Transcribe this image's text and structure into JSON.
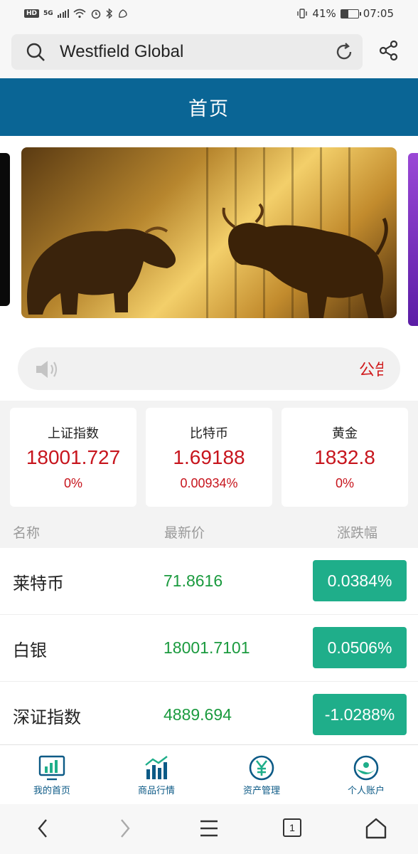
{
  "status_bar": {
    "network_badge": "HD",
    "network_type": "5G",
    "battery_level": "41%",
    "time": "07:05"
  },
  "search": {
    "value": "Westfield Global"
  },
  "header": {
    "title": "首页"
  },
  "notice": {
    "text": "公告"
  },
  "index_cards": [
    {
      "name": "上证指数",
      "price": "18001.727",
      "change": "0%"
    },
    {
      "name": "比特币",
      "price": "1.69188",
      "change": "0.00934%"
    },
    {
      "name": "黄金",
      "price": "1832.8",
      "change": "0%"
    }
  ],
  "table": {
    "headers": {
      "name": "名称",
      "price": "最新价",
      "change": "涨跌幅"
    },
    "rows": [
      {
        "name": "莱特币",
        "price": "71.8616",
        "change": "0.0384%"
      },
      {
        "name": "白银",
        "price": "18001.7101",
        "change": "0.0506%"
      },
      {
        "name": "深证指数",
        "price": "4889.694",
        "change": "-1.0288%"
      }
    ]
  },
  "tabbar": {
    "items": [
      {
        "label": "我的首页",
        "icon": "monitor-chart-icon"
      },
      {
        "label": "商品行情",
        "icon": "bar-chart-icon"
      },
      {
        "label": "资产管理",
        "icon": "yen-circle-icon"
      },
      {
        "label": "个人账户",
        "icon": "account-circle-icon"
      }
    ]
  },
  "navbar": {
    "tabs_count": "1"
  },
  "colors": {
    "header_bg": "#0a6595",
    "price_up_red": "#c7151d",
    "price_green": "#1a9a3e",
    "change_badge": "#1fae8a",
    "tab_label": "#0c5a86"
  }
}
